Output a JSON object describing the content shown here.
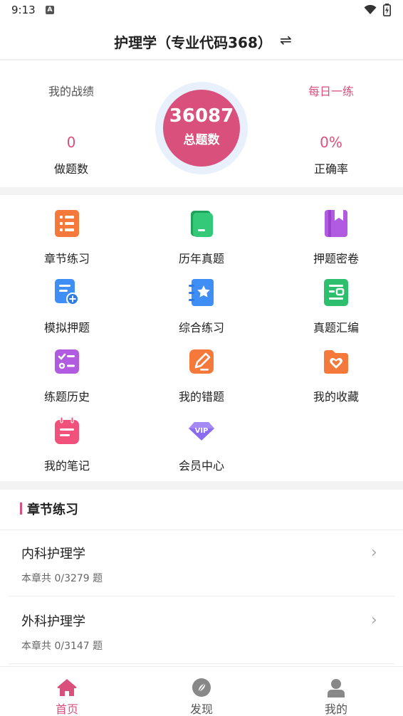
{
  "status_bar": {
    "time": "9:13",
    "badge": "A"
  },
  "header": {
    "title": "护理学（专业代码368）",
    "swap_icon": "⇌"
  },
  "stats": {
    "left_label": "我的战绩",
    "right_label": "每日一练",
    "total_value": "36087",
    "total_label": "总题数",
    "done_value": "0",
    "done_label": "做题数",
    "accuracy_value": "0%",
    "accuracy_label": "正确率"
  },
  "grid": [
    {
      "label": "章节练习",
      "icon": "list-icon",
      "color": "#f5793b"
    },
    {
      "label": "历年真题",
      "icon": "book-icon",
      "color": "#2dbf6e"
    },
    {
      "label": "押题密卷",
      "icon": "bookmark-book-icon",
      "color": "#b05be0"
    },
    {
      "label": "模拟押题",
      "icon": "doc-plus-icon",
      "color": "#3e8ef5"
    },
    {
      "label": "综合练习",
      "icon": "star-note-icon",
      "color": "#3e8ef5"
    },
    {
      "label": "真题汇编",
      "icon": "doc-lines-icon",
      "color": "#2dbf6e"
    },
    {
      "label": "练题历史",
      "icon": "checklist-icon",
      "color": "#b05be0"
    },
    {
      "label": "我的错题",
      "icon": "pencil-icon",
      "color": "#f5793b"
    },
    {
      "label": "我的收藏",
      "icon": "heart-folder-icon",
      "color": "#f5793b"
    },
    {
      "label": "我的笔记",
      "icon": "notebook-icon",
      "color": "#f0527c"
    },
    {
      "label": "会员中心",
      "icon": "vip-icon",
      "color": "#6e7cf0"
    }
  ],
  "chapter": {
    "title": "章节练习",
    "rows": [
      {
        "name": "内科护理学",
        "meta": "本章共  0/3279 题"
      },
      {
        "name": "外科护理学",
        "meta": "本章共  0/3147 题"
      }
    ]
  },
  "nav": [
    {
      "label": "首页",
      "icon": "home-icon",
      "active": true
    },
    {
      "label": "发现",
      "icon": "compass-icon",
      "active": false
    },
    {
      "label": "我的",
      "icon": "user-icon",
      "active": false
    }
  ],
  "colors": {
    "accent": "#d9507c"
  }
}
